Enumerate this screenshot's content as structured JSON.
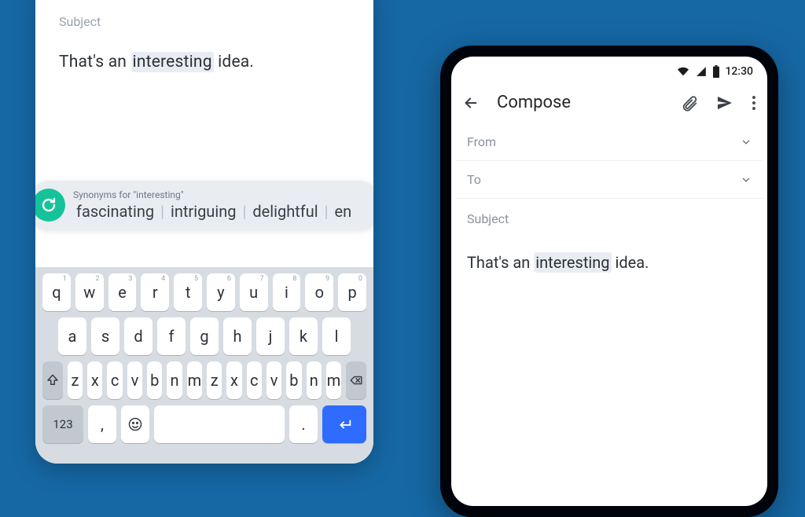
{
  "left": {
    "subject_label": "Subject",
    "body_pre": "That's an ",
    "body_hl": "interesting",
    "body_post": " idea.",
    "sugg_title": "Synonyms for \"interesting\"",
    "suggestions": [
      "fascinating",
      "intriguing",
      "delightful",
      "en"
    ],
    "keyboard": {
      "row1": [
        "q",
        "w",
        "e",
        "r",
        "t",
        "y",
        "u",
        "i",
        "o",
        "p"
      ],
      "row1_hints": [
        "1",
        "2",
        "3",
        "4",
        "5",
        "6",
        "7",
        "8",
        "9",
        "0"
      ],
      "row2": [
        "a",
        "s",
        "d",
        "f",
        "g",
        "h",
        "j",
        "k",
        "l"
      ],
      "row3": [
        "z",
        "x",
        "c",
        "v",
        "b",
        "n",
        "m"
      ],
      "num_key": "123",
      "comma": ",",
      "period": "."
    }
  },
  "right": {
    "time": "12:30",
    "title": "Compose",
    "from_label": "From",
    "to_label": "To",
    "subject_label": "Subject",
    "body_pre": "That's an ",
    "body_hl": "interesting",
    "body_post": " idea."
  }
}
